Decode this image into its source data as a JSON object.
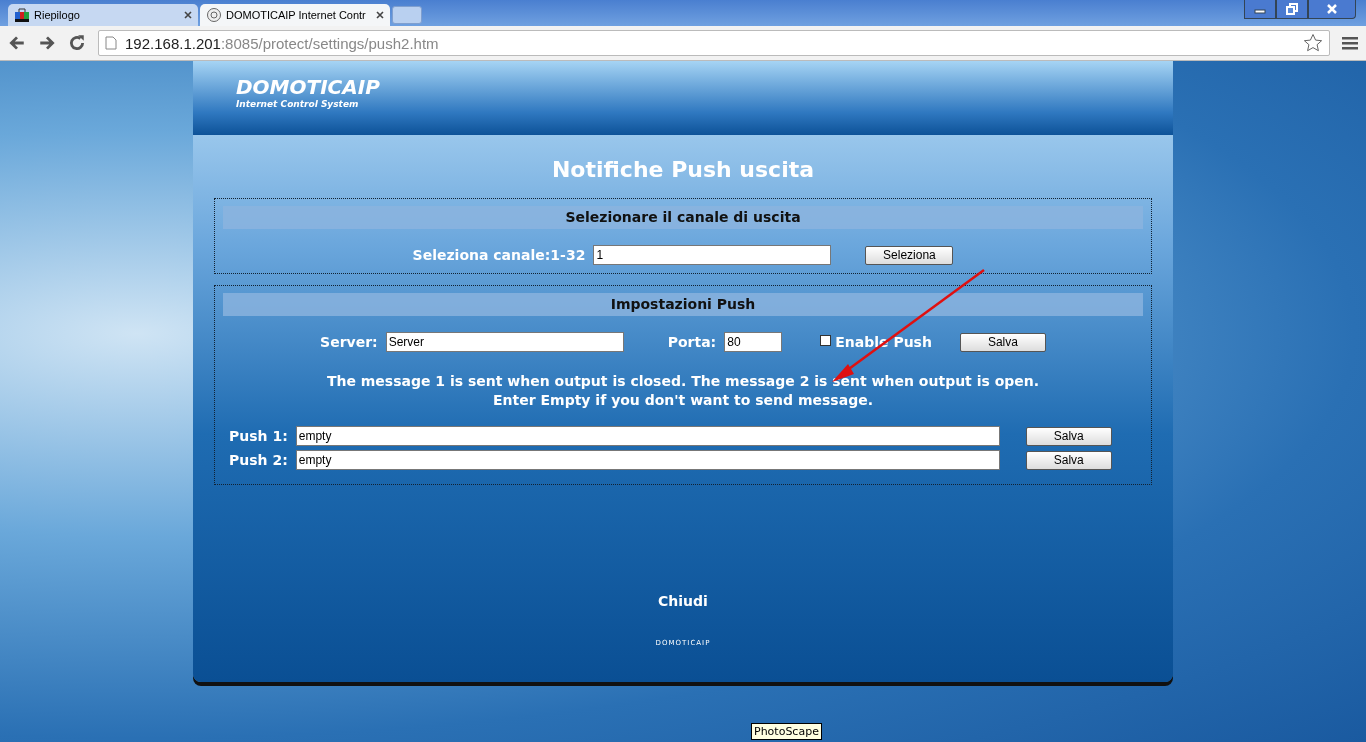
{
  "browser": {
    "tabs": [
      {
        "title": "Riepilogo",
        "selected": false
      },
      {
        "title": "DOMOTICAIP Internet Contr",
        "selected": true
      }
    ],
    "url_host": "192.168.1.201",
    "url_path": ":8085/protect/settings/push2.htm"
  },
  "header": {
    "logo": "DOMOTICAIP",
    "tagline": "Internet Control System"
  },
  "page_title": "Notifiche Push uscita",
  "channel_section": {
    "heading": "Selezionare il canale di uscita",
    "label": "Seleziona canale:1-32",
    "value": "1",
    "button": "Seleziona"
  },
  "push_section": {
    "heading": "Impostazioni Push",
    "server_label": "Server:",
    "server_value": "Server",
    "port_label": "Porta:",
    "port_value": "80",
    "enable": {
      "label": "Enable Push",
      "checked": false
    },
    "save_button": "Salva",
    "note_lines": [
      "The message 1 is sent when output is closed. The message 2 is sent when output is open.",
      "Enter Empty if you don't want to send message."
    ],
    "messages": [
      {
        "label": "Push 1:",
        "value": "empty",
        "button": "Salva"
      },
      {
        "label": "Push 2:",
        "value": "empty",
        "button": "Salva"
      }
    ]
  },
  "close_link": "Chiudi",
  "footer": "DOMOTICAIP",
  "tooltip": "PhotoScape"
}
